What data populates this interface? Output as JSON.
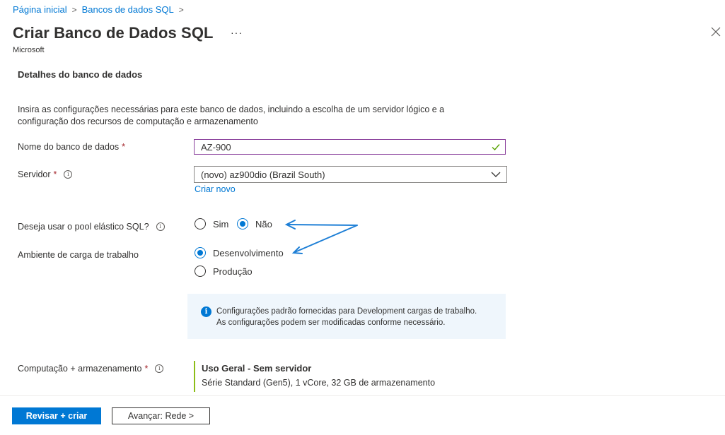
{
  "breadcrumb": {
    "items": [
      "Página inicial",
      "Bancos de dados SQL"
    ],
    "separator": ">"
  },
  "header": {
    "title": "Criar Banco de Dados SQL",
    "more": "···",
    "subtitle": "Microsoft",
    "close_icon": "close-icon"
  },
  "section": {
    "title": "Detalhes do banco de dados",
    "description_line1": "Insira as configurações necessárias para este banco de dados, incluindo a escolha de um servidor lógico e a",
    "description_line2": "configuração dos recursos de computação e armazenamento"
  },
  "form": {
    "db_name": {
      "label": "Nome do banco de dados",
      "required": "*",
      "value": "AZ-900",
      "valid_icon": "checkmark-icon"
    },
    "server": {
      "label": "Servidor",
      "required": "*",
      "info": "i",
      "value": "(novo) az900dio (Brazil South)",
      "create_link": "Criar novo"
    },
    "elastic_pool": {
      "label": "Deseja usar o pool elástico SQL?",
      "info": "i",
      "options": [
        "Sim",
        "Não"
      ],
      "selected": "Não"
    },
    "workload": {
      "label": "Ambiente de carga de trabalho",
      "options": [
        "Desenvolvimento",
        "Produção"
      ],
      "selected": "Desenvolvimento"
    },
    "info_box": {
      "icon": "info-icon",
      "line1": "Configurações padrão fornecidas para Development cargas de trabalho.",
      "line2": "As configurações podem ser modificadas conforme necessário."
    },
    "compute": {
      "label": "Computação + armazenamento",
      "required": "*",
      "info": "i",
      "tier_name": "Uso Geral",
      "tier_sep": " - ",
      "tier_type": "Sem servidor",
      "tier_detail": "Série Standard (Gen5), 1 vCore, 32 GB de armazenamento"
    }
  },
  "footer": {
    "primary_label": "Revisar + criar",
    "secondary_label": "Avançar: Rede >"
  },
  "colors": {
    "accent": "#0078d4",
    "required": "#a4262c",
    "annotation": "#1e7fd6",
    "compute_bar": "#8cbd18",
    "info_bg": "#eff6fc"
  }
}
